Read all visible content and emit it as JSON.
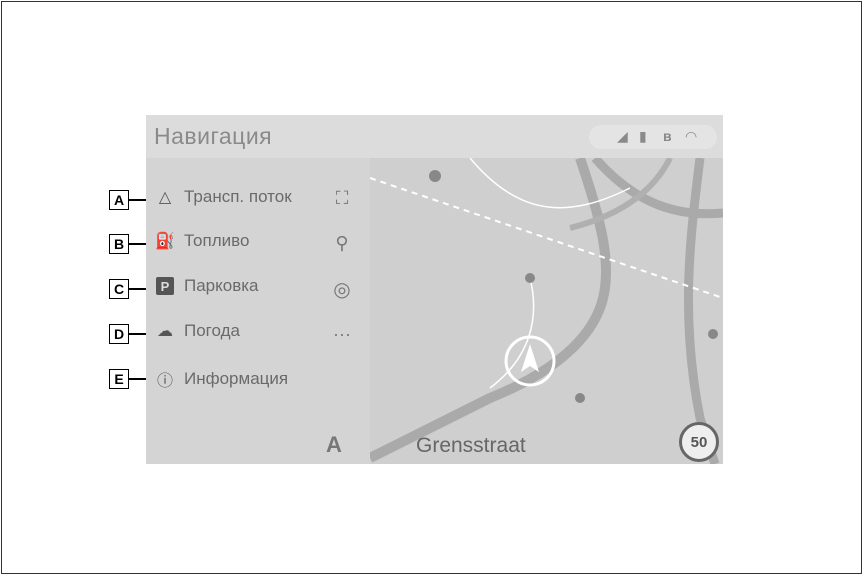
{
  "header": {
    "title": "Навигация",
    "status_icons": [
      "signal-icon",
      "battery-icon",
      "bluetooth-icon",
      "wifi-icon"
    ]
  },
  "menu": {
    "items": [
      {
        "callout": "A",
        "icon": "warning-triangle-icon",
        "label": "Трансп. поток"
      },
      {
        "callout": "B",
        "icon": "fuel-pump-icon",
        "label": "Топливо"
      },
      {
        "callout": "C",
        "icon": "parking-icon",
        "label": "Парковка",
        "icon_text": "P"
      },
      {
        "callout": "D",
        "icon": "weather-cloud-icon",
        "label": "Погода"
      },
      {
        "callout": "E",
        "icon": "info-icon",
        "label": "Информация"
      }
    ]
  },
  "tools": [
    "fullscreen-icon",
    "search-icon",
    "compass-icon",
    "more-icon"
  ],
  "map": {
    "street_name": "Grensstraat",
    "speed_limit": "50",
    "road_badge": "A"
  },
  "colors": {
    "screen_bg": "#d9d9d9",
    "map_bg": "#cfcfcf",
    "text": "#6a6a6a",
    "callout_border": "#000000"
  }
}
